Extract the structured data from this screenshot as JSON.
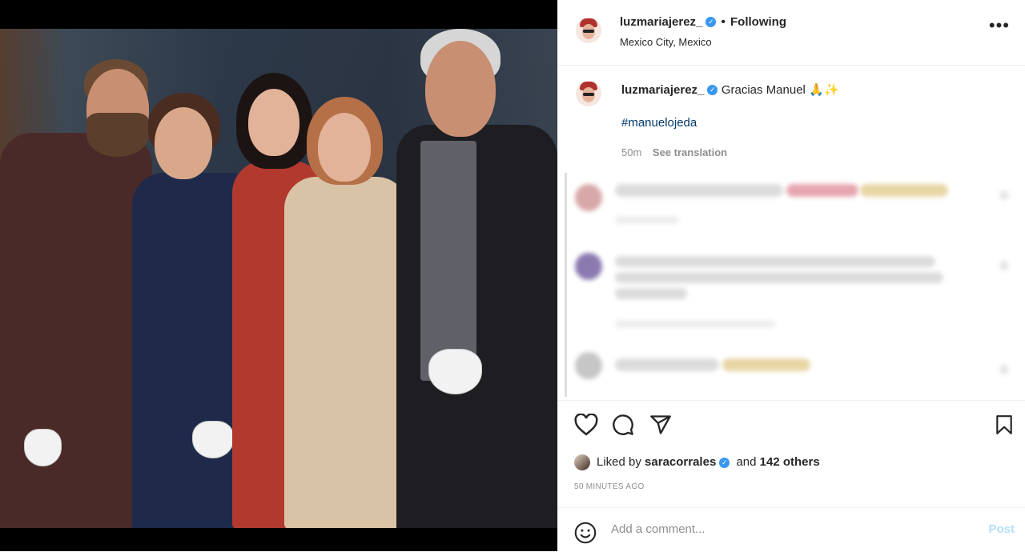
{
  "post": {
    "author": "luzmariajerez_",
    "separator": "•",
    "follow_status": "Following",
    "location": "Mexico City, Mexico",
    "more_icon": "more-horizontal-icon"
  },
  "caption": {
    "author": "luzmariajerez_",
    "text": "Gracias Manuel",
    "emoji": "🙏✨",
    "hashtag": "#manuelojeda",
    "age": "50m",
    "see_translation": "See translation"
  },
  "actions": {
    "like_icon": "heart-icon",
    "comment_icon": "comment-icon",
    "share_icon": "share-icon",
    "save_icon": "bookmark-icon"
  },
  "likes": {
    "prefix": "Liked by",
    "user": "saracorrales",
    "connector": "and",
    "count_text": "142 others"
  },
  "timestamp": "50 MINUTES AGO",
  "comment_box": {
    "emoji_icon": "emoji-icon",
    "placeholder": "Add a comment...",
    "post_label": "Post"
  },
  "colors": {
    "verified": "#3897f0",
    "hashtag": "#00376b",
    "post_disabled": "#b2dffc",
    "meta_gray": "#8e8e8e"
  }
}
